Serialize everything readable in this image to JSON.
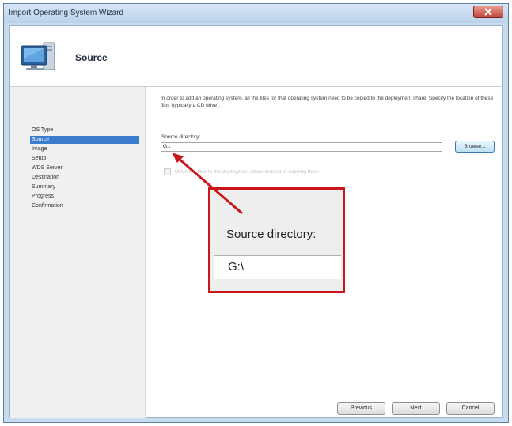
{
  "window": {
    "title": "Import Operating System Wizard"
  },
  "header": {
    "title": "Source"
  },
  "nav": {
    "items": [
      {
        "label": "OS Type"
      },
      {
        "label": "Source",
        "selected": true
      },
      {
        "label": "Image"
      },
      {
        "label": "Setup"
      },
      {
        "label": "WDS Server"
      },
      {
        "label": "Destination"
      },
      {
        "label": "Summary"
      },
      {
        "label": "Progress"
      },
      {
        "label": "Confirmation"
      }
    ]
  },
  "main": {
    "description": "In order to add an operating system, all the files for that operating system need to be copied to the deployment share.  Specify the location of these files (typically a CD drive).",
    "source_label": "Source directory:",
    "source_value": "G:\\",
    "browse_label": "Browse...",
    "move_checkbox_label": "Move the files to the deployment share instead of copying them"
  },
  "callout": {
    "label": "Source directory:",
    "value": "G:\\"
  },
  "footer": {
    "previous_label": "Previous",
    "next_label": "Next",
    "cancel_label": "Cancel"
  },
  "colors": {
    "selection": "#3c7ccf",
    "callout": "#c8161d",
    "window_frame": "#c9dcef"
  }
}
